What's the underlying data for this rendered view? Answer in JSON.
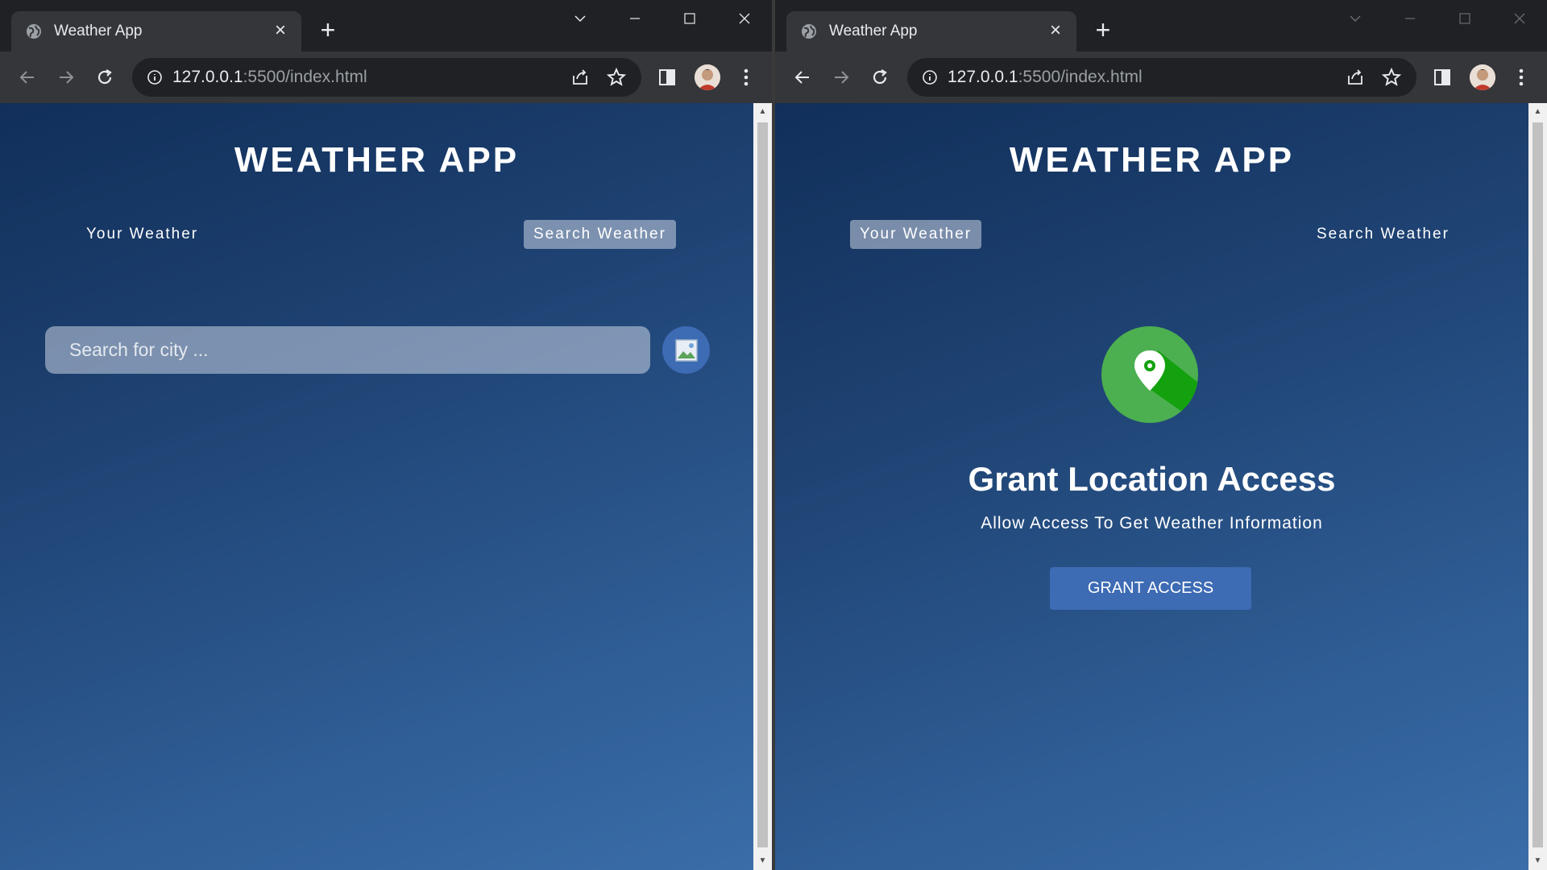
{
  "left_window": {
    "tab": {
      "title": "Weather App",
      "favicon": "globe-icon",
      "close": "×"
    },
    "new_tab": "+",
    "address": {
      "host": "127.0.0.1",
      "rest": ":5500/index.html"
    },
    "page": {
      "title": "WEATHER APP",
      "tabs": [
        {
          "label": "Your Weather",
          "active": false
        },
        {
          "label": "Search Weather",
          "active": true
        }
      ],
      "search": {
        "placeholder": "Search for city ...",
        "value": "",
        "button_icon": "broken-image-icon"
      }
    }
  },
  "right_window": {
    "tab": {
      "title": "Weather App",
      "favicon": "globe-icon",
      "close": "×"
    },
    "new_tab": "+",
    "address": {
      "host": "127.0.0.1",
      "rest": ":5500/index.html"
    },
    "page": {
      "title": "WEATHER APP",
      "tabs": [
        {
          "label": "Your Weather",
          "active": true
        },
        {
          "label": "Search Weather",
          "active": false
        }
      ],
      "grant": {
        "icon": "location-pin-icon",
        "title": "Grant Location Access",
        "subtitle": "Allow Access To Get Weather Information",
        "button": "GRANT ACCESS"
      }
    }
  },
  "colors": {
    "page_gradient_top": "#112f5a",
    "page_gradient_bottom": "#3a6da9",
    "accent_button": "#3d6bb4",
    "pin_green": "#4caf50",
    "pin_shadow": "#13a10e"
  }
}
